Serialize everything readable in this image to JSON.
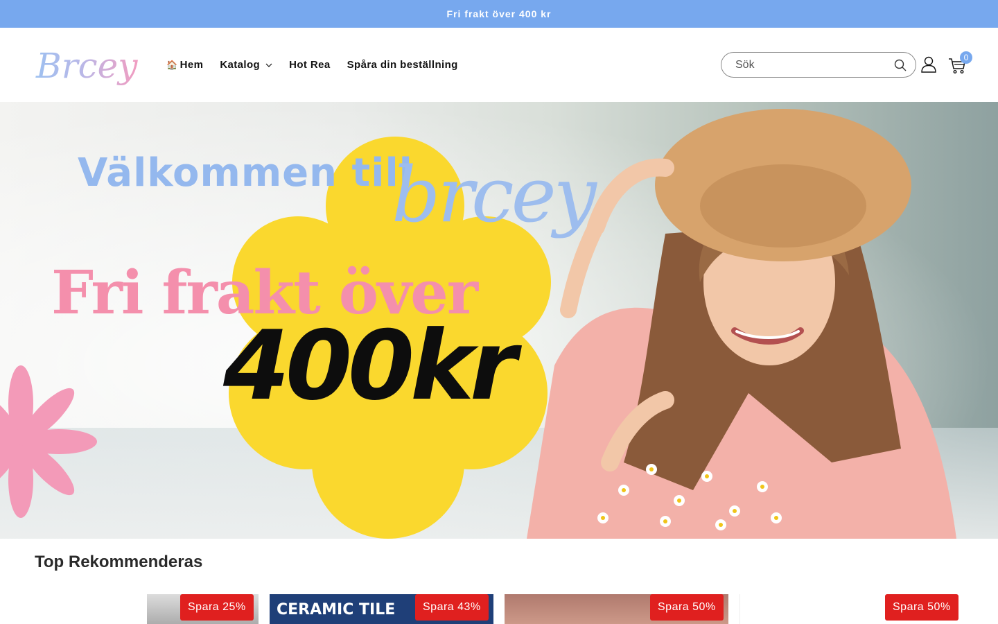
{
  "announcement": {
    "text": "Fri frakt över 400 kr"
  },
  "header": {
    "logo_text": "Brcey",
    "nav": [
      {
        "label": "Hem",
        "icon": "house-icon"
      },
      {
        "label": "Katalog",
        "has_dropdown": true
      },
      {
        "label": "Hot Rea"
      },
      {
        "label": "Spåra din beställning"
      }
    ],
    "search": {
      "placeholder": "Sök",
      "value": ""
    },
    "cart_count": "0"
  },
  "hero": {
    "welcome": "Välkommen till",
    "script_brand": "brcey",
    "headline": "Fri frakt över",
    "amount": "400kr"
  },
  "recommended": {
    "title": "Top Rekommenderas",
    "products": [
      {
        "badge": "Spara 25%"
      },
      {
        "badge": "Spara 43%",
        "thumb_text": "CERAMIC TILE"
      },
      {
        "badge": "Spara 50%"
      },
      {
        "badge": "Spara 50%"
      }
    ]
  },
  "colors": {
    "accent": "#77a8ee",
    "sale_badge": "#e0201f",
    "hero_pink": "#f48fac",
    "hero_yellow": "#fad82e"
  }
}
